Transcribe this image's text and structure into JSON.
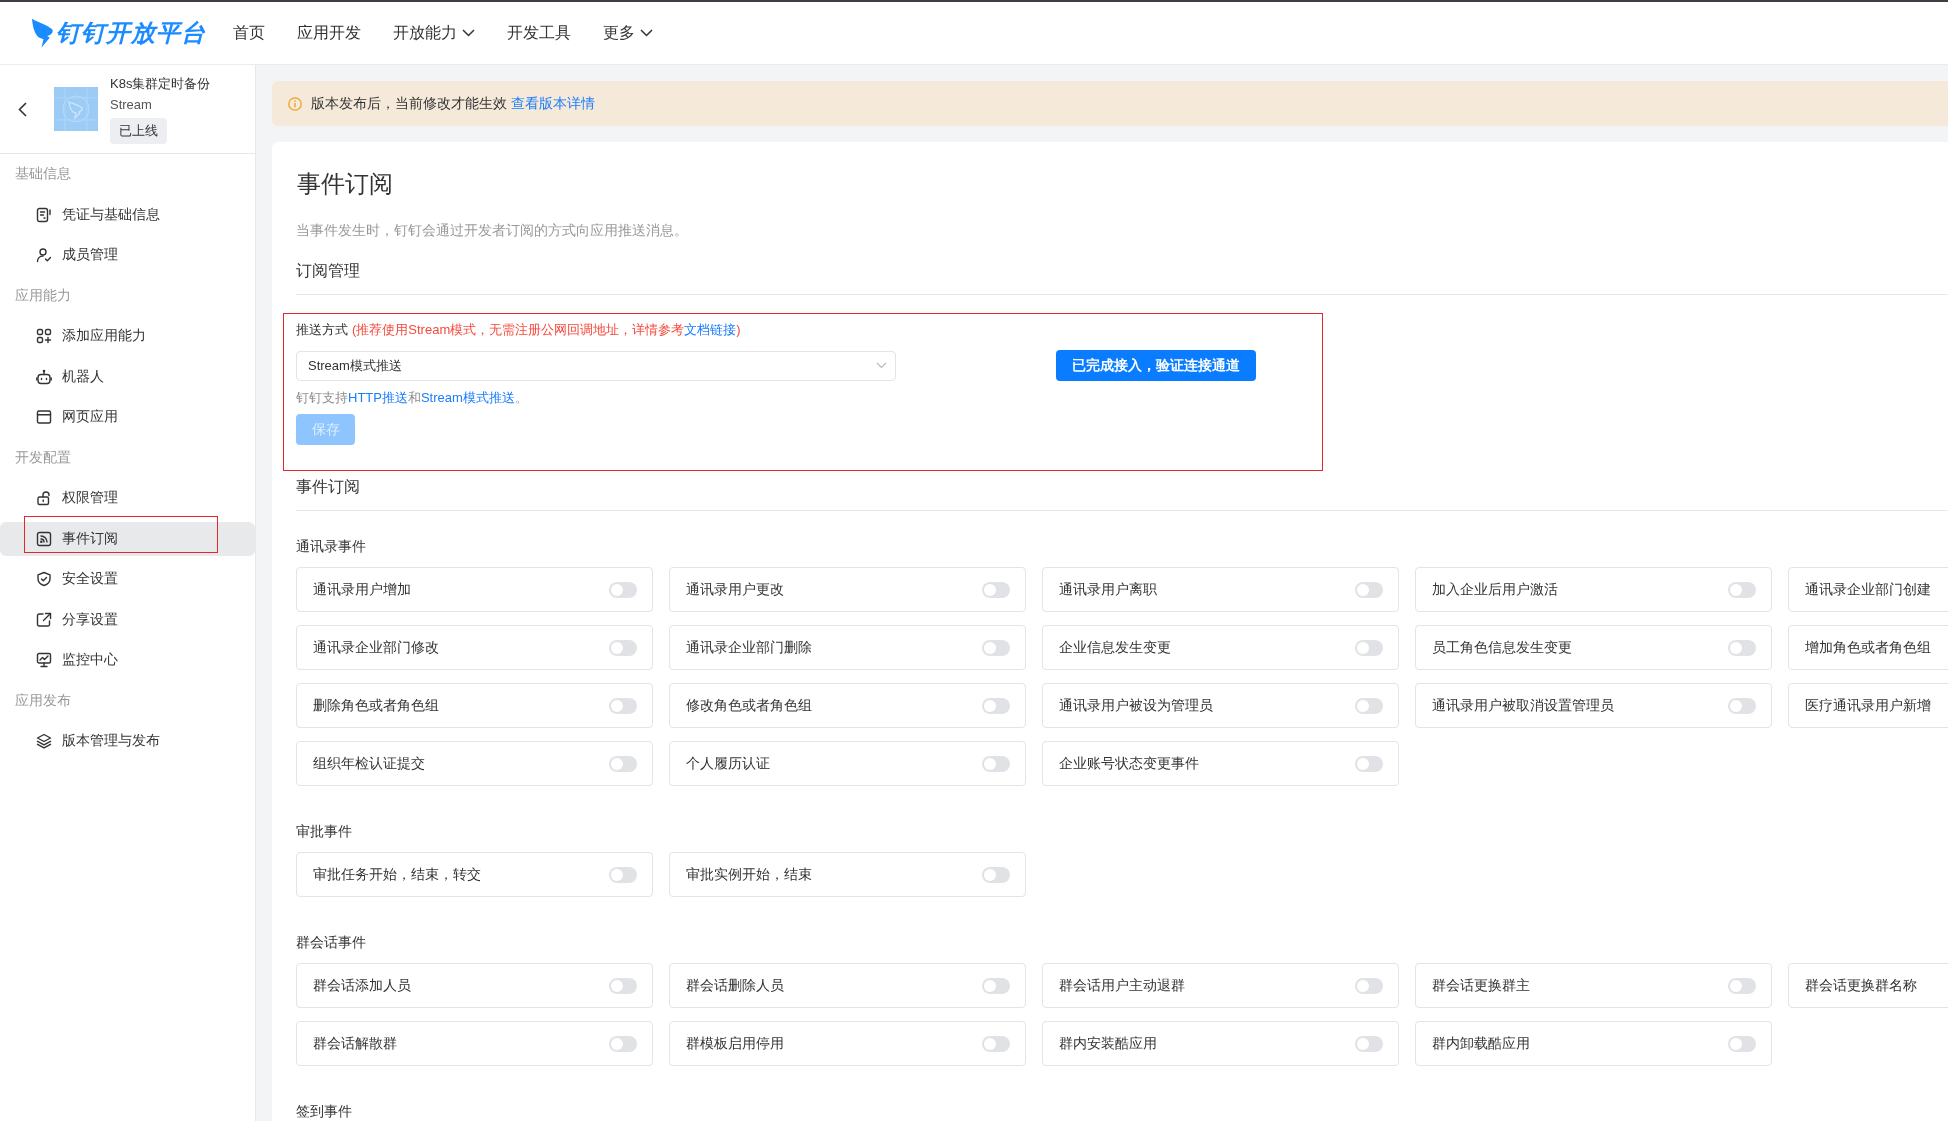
{
  "header": {
    "logo": "钉钉开放平台",
    "nav": [
      {
        "label": "首页",
        "dropdown": false
      },
      {
        "label": "应用开发",
        "dropdown": false
      },
      {
        "label": "开放能力",
        "dropdown": true
      },
      {
        "label": "开发工具",
        "dropdown": false
      },
      {
        "label": "更多",
        "dropdown": true
      }
    ]
  },
  "app": {
    "name": "K8s集群定时备份",
    "mode": "Stream",
    "status": "已上线"
  },
  "sidebar": {
    "sections": [
      {
        "title": "基础信息",
        "items": [
          {
            "label": "凭证与基础信息",
            "selected": false,
            "highlighted": false
          },
          {
            "label": "成员管理",
            "selected": false,
            "highlighted": false
          }
        ]
      },
      {
        "title": "应用能力",
        "items": [
          {
            "label": "添加应用能力",
            "selected": false,
            "highlighted": false
          },
          {
            "label": "机器人",
            "selected": false,
            "highlighted": false
          },
          {
            "label": "网页应用",
            "selected": false,
            "highlighted": false
          }
        ]
      },
      {
        "title": "开发配置",
        "items": [
          {
            "label": "权限管理",
            "selected": false,
            "highlighted": false
          },
          {
            "label": "事件订阅",
            "selected": true,
            "highlighted": true
          },
          {
            "label": "安全设置",
            "selected": false,
            "highlighted": false
          },
          {
            "label": "分享设置",
            "selected": false,
            "highlighted": false
          },
          {
            "label": "监控中心",
            "selected": false,
            "highlighted": false
          }
        ]
      },
      {
        "title": "应用发布",
        "items": [
          {
            "label": "版本管理与发布",
            "selected": false,
            "highlighted": false
          }
        ]
      }
    ]
  },
  "notice": {
    "text": "版本发布后，当前修改才能生效",
    "link": "查看版本详情"
  },
  "page": {
    "title": "事件订阅",
    "description": "当事件发生时，钉钉会通过开发者订阅的方式向应用推送消息。"
  },
  "subscription": {
    "heading": "订阅管理",
    "highlighted": true,
    "label": "推送方式",
    "hint": {
      "before": "(推荐使用Stream模式，无需注册公网回调地址，详情参考",
      "link": "文档链接",
      "after": ")"
    },
    "select": {
      "value": "Stream模式推送"
    },
    "verify_button": "已完成接入，验证连接通道",
    "support_text": [
      {
        "kind": "text",
        "text": "钉钉支持"
      },
      {
        "kind": "link",
        "text": "HTTP推送"
      },
      {
        "kind": "text",
        "text": "和"
      },
      {
        "kind": "link",
        "text": "Stream模式推送"
      },
      {
        "kind": "text",
        "text": "。"
      }
    ],
    "save_button": {
      "label": "保存",
      "disabled": true
    }
  },
  "events": {
    "heading": "事件订阅",
    "groups": [
      {
        "title": "通讯录事件",
        "items": [
          {
            "label": "通讯录用户增加",
            "on": false
          },
          {
            "label": "通讯录用户更改",
            "on": false
          },
          {
            "label": "通讯录用户离职",
            "on": false
          },
          {
            "label": "加入企业后用户激活",
            "on": false
          },
          {
            "label": "通讯录企业部门创建"
          },
          {
            "label": "通讯录企业部门修改",
            "on": false
          },
          {
            "label": "通讯录企业部门删除",
            "on": false
          },
          {
            "label": "企业信息发生变更",
            "on": false
          },
          {
            "label": "员工角色信息发生变更",
            "on": false
          },
          {
            "label": "增加角色或者角色组"
          },
          {
            "label": "删除角色或者角色组",
            "on": false
          },
          {
            "label": "修改角色或者角色组",
            "on": false
          },
          {
            "label": "通讯录用户被设为管理员",
            "on": false
          },
          {
            "label": "通讯录用户被取消设置管理员",
            "on": false
          },
          {
            "label": "医疗通讯录用户新增"
          },
          {
            "label": "组织年检认证提交",
            "on": false
          },
          {
            "label": "个人履历认证",
            "on": false
          },
          {
            "label": "企业账号状态变更事件",
            "on": false
          }
        ]
      },
      {
        "title": "审批事件",
        "items": [
          {
            "label": "审批任务开始，结束，转交",
            "on": false
          },
          {
            "label": "审批实例开始，结束",
            "on": false
          }
        ]
      },
      {
        "title": "群会话事件",
        "items": [
          {
            "label": "群会话添加人员",
            "on": false
          },
          {
            "label": "群会话删除人员",
            "on": false
          },
          {
            "label": "群会话用户主动退群",
            "on": false
          },
          {
            "label": "群会话更换群主",
            "on": false
          },
          {
            "label": "群会话更换群名称"
          },
          {
            "label": "群会话解散群",
            "on": false
          },
          {
            "label": "群模板启用停用",
            "on": false
          },
          {
            "label": "群内安装酷应用",
            "on": false
          },
          {
            "label": "群内卸载酷应用",
            "on": false
          }
        ]
      },
      {
        "title": "签到事件"
      }
    ]
  }
}
